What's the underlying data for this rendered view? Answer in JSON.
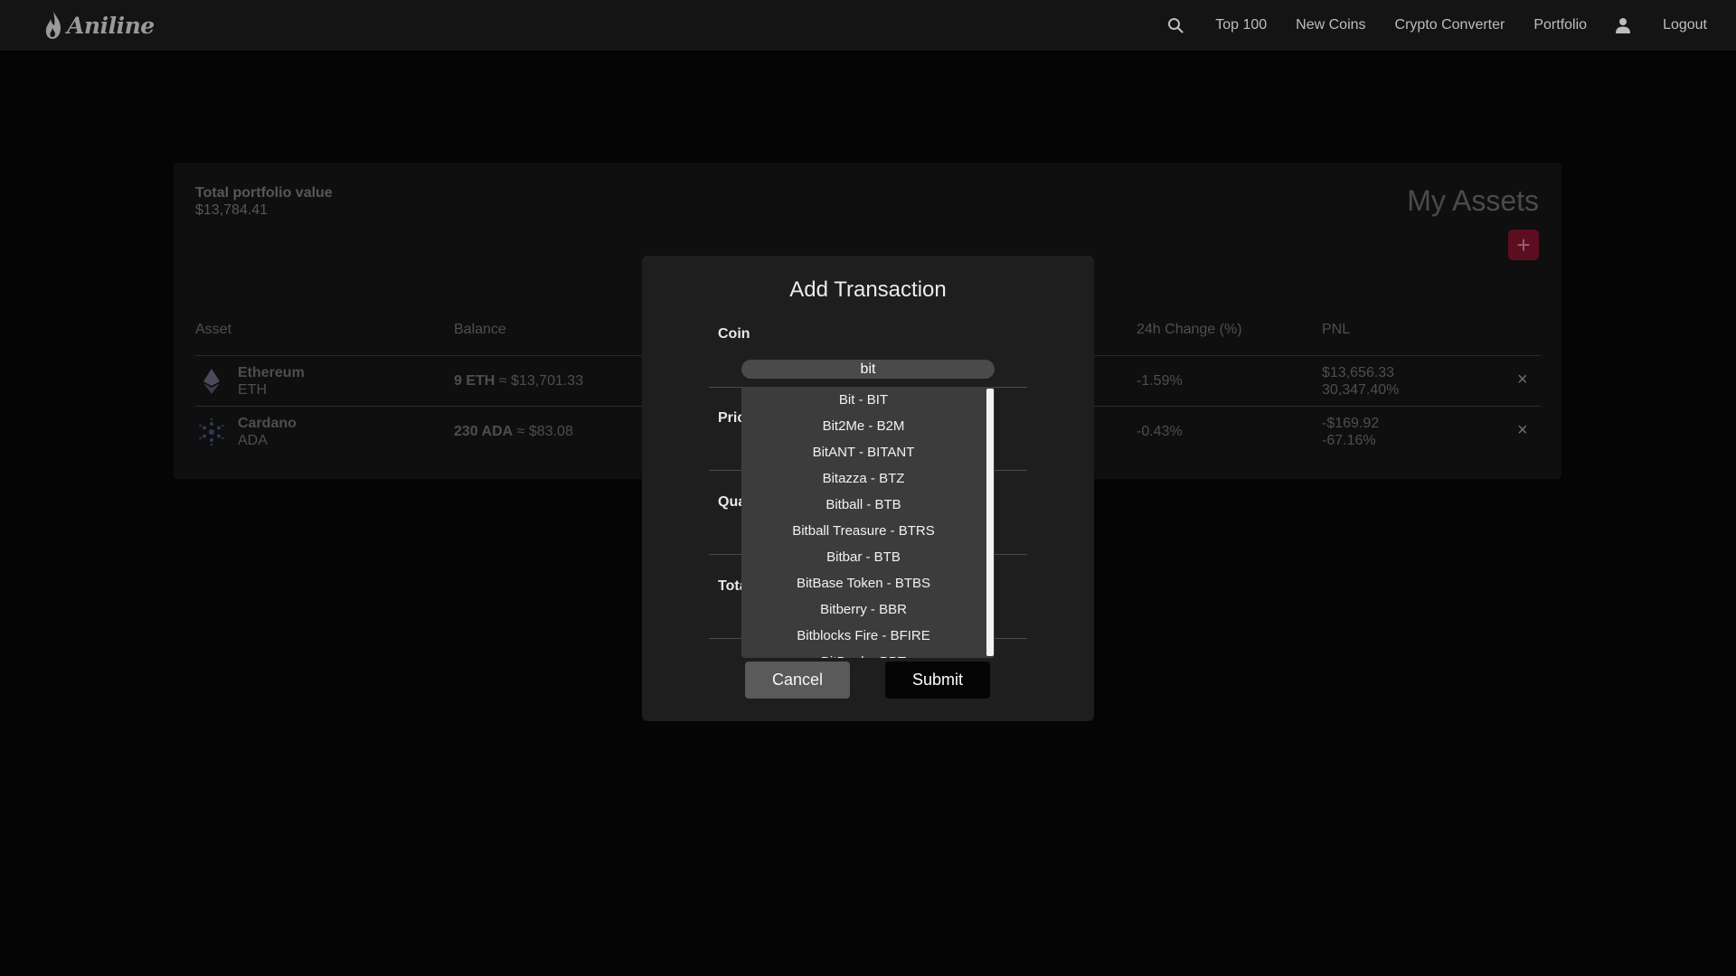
{
  "brand": {
    "name": "Aniline"
  },
  "navbar": {
    "links": [
      "Top 100",
      "New Coins",
      "Crypto Converter",
      "Portfolio"
    ],
    "logout": "Logout",
    "icons": [
      "search-icon",
      "user-icon"
    ]
  },
  "portfolio": {
    "total_label": "Total portfolio value",
    "total_value": "$13,784.41",
    "title": "My Assets",
    "add_button": "+",
    "columns": [
      "Asset",
      "Balance",
      "24h Change (%)",
      "PNL"
    ],
    "rows": [
      {
        "name": "Ethereum",
        "symbol": "ETH",
        "balance_qty": "9 ETH",
        "balance_value": "≈ $13,701.33",
        "change": "-1.59%",
        "pnl": "$13,656.33",
        "pnl_pct": "30,347.40%",
        "remove": "×",
        "icon": "ethereum-icon"
      },
      {
        "name": "Cardano",
        "symbol": "ADA",
        "balance_qty": "230 ADA",
        "balance_value": "≈ $83.08",
        "change": "-0.43%",
        "pnl": "-$169.92",
        "pnl_pct": "-67.16%",
        "remove": "×",
        "icon": "cardano-icon"
      }
    ]
  },
  "modal": {
    "title": "Add Transaction",
    "coin_label": "Coin",
    "coin_value": "bit",
    "price_label": "Pric",
    "quantity_label": "Qua",
    "total_label": "Tota",
    "options": [
      "Bit - BIT",
      "Bit2Me - B2M",
      "BitANT - BITANT",
      "Bitazza - BTZ",
      "Bitball - BTB",
      "Bitball Treasure - BTRS",
      "Bitbar - BTB",
      "BitBase Token - BTBS",
      "Bitberry - BBR",
      "Bitblocks Fire - BFIRE",
      "BitBook - BBT"
    ],
    "cancel": "Cancel",
    "submit": "Submit"
  },
  "colors": {
    "accent": "#5c0d20",
    "background": "#050505",
    "modal": "#1e1e1e"
  }
}
